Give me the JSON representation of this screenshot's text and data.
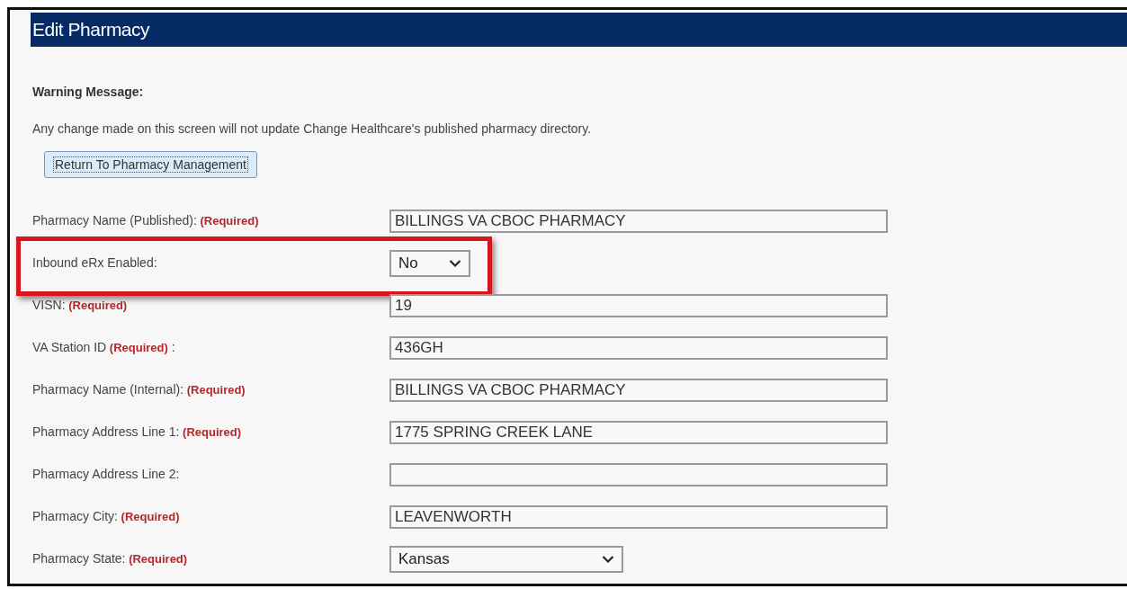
{
  "header": {
    "title": "Edit Pharmacy"
  },
  "warning": {
    "title": "Warning Message:",
    "text": "Any change made on this screen will not update Change Healthcare's published pharmacy directory."
  },
  "return_button": {
    "label": "Return To Pharmacy Management"
  },
  "fields": [
    {
      "kind": "text",
      "label": "Pharmacy Name (Published):",
      "required": "(Required)",
      "value": "BILLINGS VA CBOC PHARMACY"
    },
    {
      "kind": "toggle",
      "label": "Inbound eRx Enabled:",
      "value": "No",
      "highlighted": true
    },
    {
      "kind": "text",
      "label": "VISN:",
      "required": "(Required)",
      "value": "19"
    },
    {
      "kind": "text",
      "label": "VA Station ID",
      "required": "(Required)",
      "suffix": ":",
      "value": "436GH"
    },
    {
      "kind": "text",
      "label": "Pharmacy Name (Internal):",
      "required": "(Required)",
      "value": "BILLINGS VA CBOC PHARMACY"
    },
    {
      "kind": "text",
      "label": "Pharmacy Address Line 1:",
      "required": "(Required)",
      "value": "1775 SPRING CREEK LANE"
    },
    {
      "kind": "text",
      "label": "Pharmacy Address Line 2:"
    },
    {
      "kind": "text",
      "label": "Pharmacy City:",
      "required": "(Required)",
      "value": "LEAVENWORTH"
    },
    {
      "kind": "select",
      "label": "Pharmacy State:",
      "required": "(Required)",
      "value": "Kansas"
    }
  ]
}
